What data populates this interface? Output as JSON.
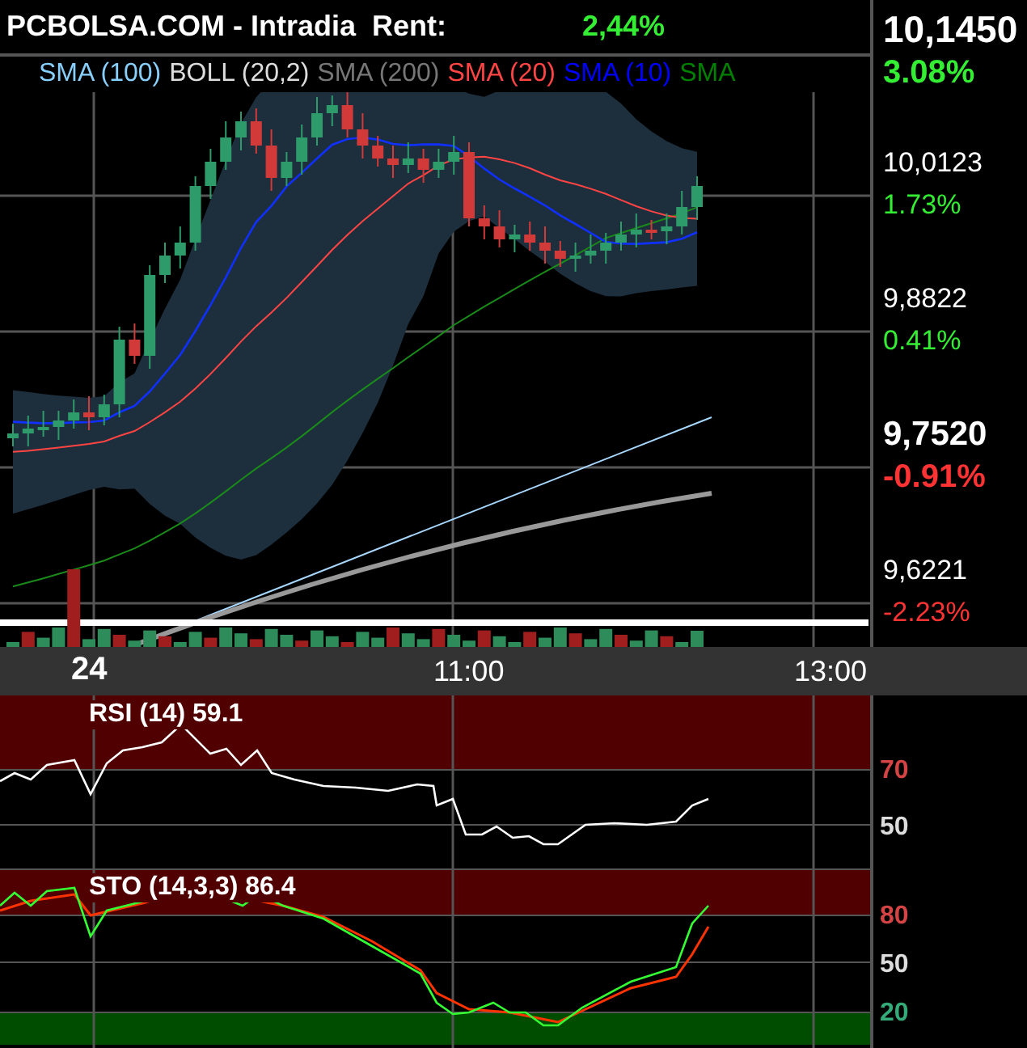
{
  "header": {
    "title": "PCBOLSA.COM - Intradia  Rent:",
    "rent": "2,44%"
  },
  "legend": [
    {
      "label": "SMA (100)",
      "color": "#87cefa"
    },
    {
      "label": "BOLL (20,2)",
      "color": "#dddddd"
    },
    {
      "label": "SMA (200)",
      "color": "#777777"
    },
    {
      "label": "SMA (20)",
      "color": "#ff4444"
    },
    {
      "label": "SMA (10)",
      "color": "#0000ff"
    },
    {
      "label": "SMA",
      "color": "#008000"
    }
  ],
  "price_axis": [
    {
      "price": "10,1450",
      "change": "3.08%",
      "kind": "high",
      "color": "#33ee33"
    },
    {
      "price": "10,0123",
      "change": "1.73%",
      "kind": "tick",
      "color": "#33ee33"
    },
    {
      "price": "9,8822",
      "change": "0.41%",
      "kind": "tick",
      "color": "#33ee33"
    },
    {
      "price": "9,7520",
      "change": "-0.91%",
      "kind": "current",
      "color": "#ff3333"
    },
    {
      "price": "9,6221",
      "change": "-2.23%",
      "kind": "tick",
      "color": "#ff3333"
    }
  ],
  "time_axis": [
    {
      "label": "24",
      "kind": "day"
    },
    {
      "label": "11:00",
      "kind": "time"
    },
    {
      "label": "13:00",
      "kind": "time"
    }
  ],
  "rsi": {
    "label": "RSI (14) 59.1",
    "levels": [
      {
        "label": "70",
        "color": "#d44444"
      },
      {
        "label": "50",
        "color": "#dddddd"
      }
    ]
  },
  "sto": {
    "label": "STO (14,3,3) 86.4",
    "levels": [
      {
        "label": "80",
        "color": "#d44444"
      },
      {
        "label": "50",
        "color": "#dddddd"
      },
      {
        "label": "20",
        "color": "#33aa77"
      }
    ]
  }
}
